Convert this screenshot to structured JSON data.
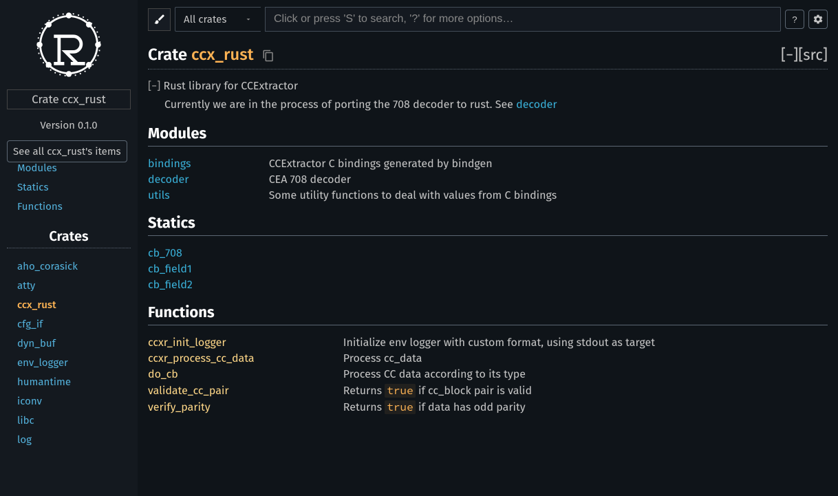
{
  "sidebar": {
    "location_prefix": "Crate ",
    "location_name": "ccx_rust",
    "version": "Version 0.1.0",
    "see_all": "See all ccx_rust's items",
    "blocks": [
      "Modules",
      "Statics",
      "Functions"
    ],
    "crates_heading": "Crates",
    "crates": [
      "aho_corasick",
      "atty",
      "ccx_rust",
      "cfg_if",
      "dyn_buf",
      "env_logger",
      "humantime",
      "iconv",
      "libc",
      "log"
    ],
    "current_crate": "ccx_rust"
  },
  "topbar": {
    "crate_select": "All crates",
    "search_placeholder": "Click or press 'S' to search, '?' for more options…",
    "help": "?",
    "settings_title": "Settings"
  },
  "heading": {
    "kind": "Crate ",
    "name": "ccx_rust",
    "collapse": "[−]",
    "src": "[src]"
  },
  "doc": {
    "toggle": "[−] ",
    "summary": "Rust library for CCExtractor",
    "para_prefix": "Currently we are in the process of porting the 708 decoder to rust. See ",
    "para_link": "decoder"
  },
  "sections": {
    "modules_title": "Modules",
    "modules": [
      {
        "name": "bindings",
        "desc": "CCExtractor C bindings generated by bindgen"
      },
      {
        "name": "decoder",
        "desc": "CEA 708 decoder"
      },
      {
        "name": "utils",
        "desc": "Some utility functions to deal with values from C bindings"
      }
    ],
    "statics_title": "Statics",
    "statics": [
      "cb_708",
      "cb_field1",
      "cb_field2"
    ],
    "functions_title": "Functions",
    "functions": [
      {
        "name": "ccxr_init_logger",
        "desc_parts": [
          "Initialize env logger with custom format, using stdout as target"
        ]
      },
      {
        "name": "ccxr_process_cc_data",
        "desc_parts": [
          "Process cc_data"
        ]
      },
      {
        "name": "do_cb",
        "desc_parts": [
          "Process CC data according to its type"
        ]
      },
      {
        "name": "validate_cc_pair",
        "desc_parts": [
          "Returns ",
          "true",
          " if cc_block pair is valid"
        ]
      },
      {
        "name": "verify_parity",
        "desc_parts": [
          "Returns ",
          "true",
          " if data has odd parity"
        ]
      }
    ]
  }
}
